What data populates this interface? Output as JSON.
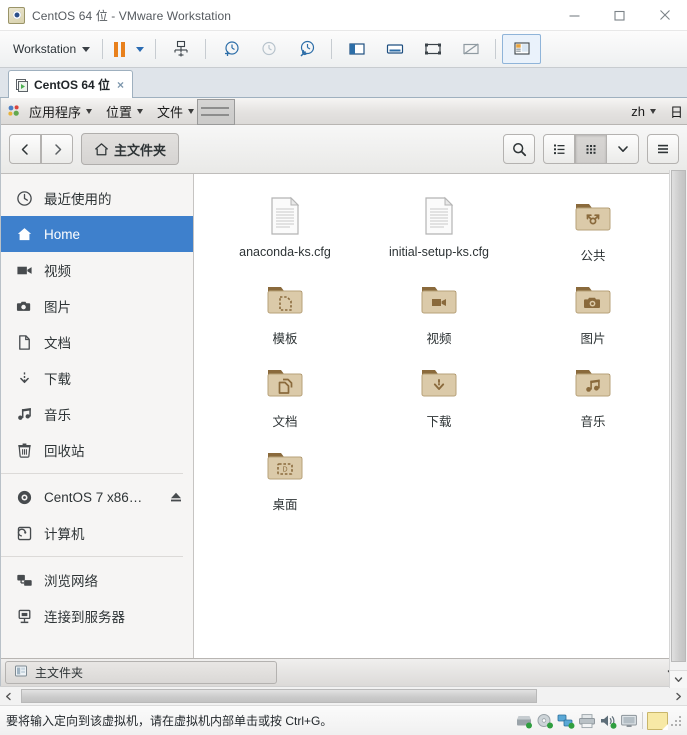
{
  "window": {
    "title": "CentOS 64 位 - VMware Workstation",
    "app_icon": "vmware-logo-icon",
    "controls": {
      "minimize": "minimize-icon",
      "maximize": "maximize-icon",
      "close": "close-icon"
    }
  },
  "vm_toolbar": {
    "workstation_label": "Workstation",
    "items": [
      {
        "name": "workstation-menu",
        "label": "Workstation",
        "icon": "chevron-down-icon"
      },
      {
        "name": "suspend-button",
        "label": "",
        "icon": "pause-icon"
      },
      {
        "name": "power-dropdown",
        "label": "",
        "icon": "chevron-down-blue-icon"
      },
      {
        "name": "manage-snapshots-button",
        "label": "",
        "icon": "snapshot-manager-icon"
      },
      {
        "name": "take-snapshot-button",
        "label": "",
        "icon": "snapshot-add-icon"
      },
      {
        "name": "revert-snapshot-button",
        "label": "",
        "icon": "snapshot-revert-icon"
      },
      {
        "name": "snapshot-manager-button",
        "label": "",
        "icon": "snapshot-wrench-icon"
      },
      {
        "name": "show-library-button",
        "label": "",
        "icon": "sidebar-panel-icon"
      },
      {
        "name": "show-console-button",
        "label": "",
        "icon": "console-view-icon"
      },
      {
        "name": "enter-fullscreen-button",
        "label": "",
        "icon": "fullscreen-icon"
      },
      {
        "name": "unity-mode-button",
        "label": "",
        "icon": "unity-mode-icon"
      },
      {
        "name": "show-thumbnail-bar-button",
        "label": "",
        "icon": "thumbnail-bar-icon"
      }
    ]
  },
  "vm_tab": {
    "label": "CentOS 64 位",
    "close": "×",
    "icon": "virtual-machine-icon"
  },
  "gnome_panel": {
    "logo": "gnome-foot-icon",
    "menus": [
      {
        "name": "applications-menu",
        "label": "应用程序"
      },
      {
        "name": "places-menu",
        "label": "位置"
      },
      {
        "name": "files-menu",
        "label": "文件"
      }
    ],
    "right": {
      "input_source": "zh",
      "clock": "日"
    }
  },
  "nautilus": {
    "header": {
      "back": "back-icon",
      "forward": "forward-icon",
      "path_label": "主文件夹",
      "path_icon": "home-icon",
      "search": "search-icon",
      "list_view": "list-view-icon",
      "grid_view": "grid-view-icon",
      "view_options": "chevron-down-icon",
      "menu": "hamburger-menu-icon"
    },
    "sidebar": [
      {
        "name": "sidebar-item-recent",
        "label": "最近使用的",
        "icon": "clock-icon",
        "selected": false,
        "eject": false
      },
      {
        "name": "sidebar-item-home",
        "label": "Home",
        "icon": "home-icon",
        "selected": true,
        "eject": false
      },
      {
        "name": "sidebar-item-videos",
        "label": "视频",
        "icon": "video-icon",
        "selected": false,
        "eject": false
      },
      {
        "name": "sidebar-item-pictures",
        "label": "图片",
        "icon": "camera-icon",
        "selected": false,
        "eject": false
      },
      {
        "name": "sidebar-item-documents",
        "label": "文档",
        "icon": "document-icon",
        "selected": false,
        "eject": false
      },
      {
        "name": "sidebar-item-downloads",
        "label": "下载",
        "icon": "download-icon",
        "selected": false,
        "eject": false
      },
      {
        "name": "sidebar-item-music",
        "label": "音乐",
        "icon": "music-icon",
        "selected": false,
        "eject": false
      },
      {
        "name": "sidebar-item-trash",
        "label": "回收站",
        "icon": "trash-icon",
        "selected": false,
        "eject": false
      },
      {
        "name": "sidebar-item-cdrom",
        "label": "CentOS 7 x86…",
        "icon": "disc-icon",
        "selected": false,
        "eject": true
      },
      {
        "name": "sidebar-item-computer",
        "label": "计算机",
        "icon": "computer-icon",
        "selected": false,
        "eject": false
      },
      {
        "name": "sidebar-item-network",
        "label": "浏览网络",
        "icon": "network-icon",
        "selected": false,
        "eject": false
      },
      {
        "name": "sidebar-item-connect",
        "label": "连接到服务器",
        "icon": "server-icon",
        "selected": false,
        "eject": false
      }
    ],
    "files": [
      {
        "name": "file-item-anaconda-ks",
        "label": "anaconda-ks.cfg",
        "type": "text-file",
        "emblem": "none"
      },
      {
        "name": "file-item-initial-setup-ks",
        "label": "initial-setup-ks.cfg",
        "type": "text-file",
        "emblem": "none"
      },
      {
        "name": "file-item-public",
        "label": "公共",
        "type": "folder",
        "emblem": "share"
      },
      {
        "name": "file-item-templates",
        "label": "模板",
        "type": "folder",
        "emblem": "template"
      },
      {
        "name": "file-item-videos",
        "label": "视频",
        "type": "folder",
        "emblem": "video"
      },
      {
        "name": "file-item-pictures",
        "label": "图片",
        "type": "folder",
        "emblem": "camera"
      },
      {
        "name": "file-item-documents",
        "label": "文档",
        "type": "folder",
        "emblem": "documents"
      },
      {
        "name": "file-item-downloads",
        "label": "下载",
        "type": "folder",
        "emblem": "download"
      },
      {
        "name": "file-item-music",
        "label": "音乐",
        "type": "folder",
        "emblem": "music"
      },
      {
        "name": "file-item-desktop",
        "label": "桌面",
        "type": "folder",
        "emblem": "desktop"
      }
    ]
  },
  "gnome_taskbar": {
    "window_button": {
      "label": "主文件夹",
      "icon": "file-manager-icon"
    },
    "expand": "chevron-down-icon"
  },
  "status_bar": {
    "message": "要将输入定向到该虚拟机，请在虚拟机内部单击或按 Ctrl+G。",
    "devices": [
      {
        "name": "hard-disk-device-icon",
        "label": "hard-disk"
      },
      {
        "name": "cd-dvd-device-icon",
        "label": "cd-dvd"
      },
      {
        "name": "network-device-icon",
        "label": "network-adapter"
      },
      {
        "name": "printer-device-icon",
        "label": "printer"
      },
      {
        "name": "sound-device-icon",
        "label": "sound-card"
      },
      {
        "name": "display-device-icon",
        "label": "display"
      }
    ],
    "note": "note-icon"
  },
  "colors": {
    "selection_blue": "#3e80cc",
    "folder_tan": "#d9c9ab",
    "folder_tab_brown": "#8a6a3c",
    "accent_orange": "#e8801c",
    "panel_gray": "#e4e2e0"
  }
}
